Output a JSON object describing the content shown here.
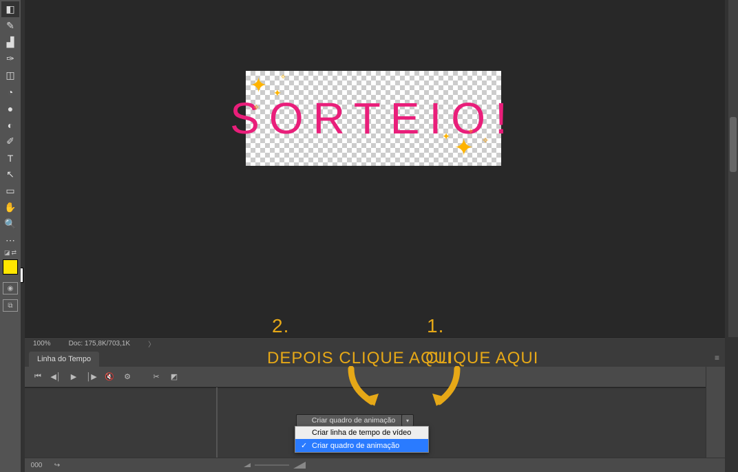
{
  "tools": [
    {
      "name": "eraser-tool-icon",
      "glyph": "◧"
    },
    {
      "name": "brush-tool-icon",
      "glyph": "✎"
    },
    {
      "name": "stamp-tool-icon",
      "glyph": "▟"
    },
    {
      "name": "history-brush-icon",
      "glyph": "✑"
    },
    {
      "name": "gradient-tool-icon",
      "glyph": "◫"
    },
    {
      "name": "bucket-tool-icon",
      "glyph": "◔"
    },
    {
      "name": "blur-tool-icon",
      "glyph": "●"
    },
    {
      "name": "dodge-tool-icon",
      "glyph": "◐"
    },
    {
      "name": "pen-tool-icon",
      "glyph": "✐"
    },
    {
      "name": "type-tool-icon",
      "glyph": "T"
    },
    {
      "name": "path-select-icon",
      "glyph": "↖"
    },
    {
      "name": "rectangle-tool-icon",
      "glyph": "▭"
    },
    {
      "name": "hand-tool-icon",
      "glyph": "✋"
    },
    {
      "name": "zoom-tool-icon",
      "glyph": "🔍"
    },
    {
      "name": "more-tools-icon",
      "glyph": "⋯"
    }
  ],
  "canvas": {
    "text": "SORTEIO!"
  },
  "status": {
    "zoom": "100%",
    "doc_info": "Doc: 175,8K/703,1K"
  },
  "timeline": {
    "tab_label": "Linha do Tempo",
    "buttons": {
      "first": "⏮",
      "prev": "◀│",
      "play": "▶",
      "next": "│▶",
      "mute": "🔇",
      "settings": "⚙",
      "cut": "✂",
      "transition": "◩"
    },
    "create_button_label": "Criar quadro de animação",
    "menu": {
      "video": "Criar linha de tempo de vídeo",
      "frame": "Criar quadro de animação"
    },
    "footer": {
      "label": "000",
      "convert_icon": "↪"
    }
  },
  "annotations": {
    "n1": "1.",
    "n2": "2.",
    "t1": "CLIQUE AQUI",
    "t2": "DEPOIS CLIQUE AQUI"
  }
}
